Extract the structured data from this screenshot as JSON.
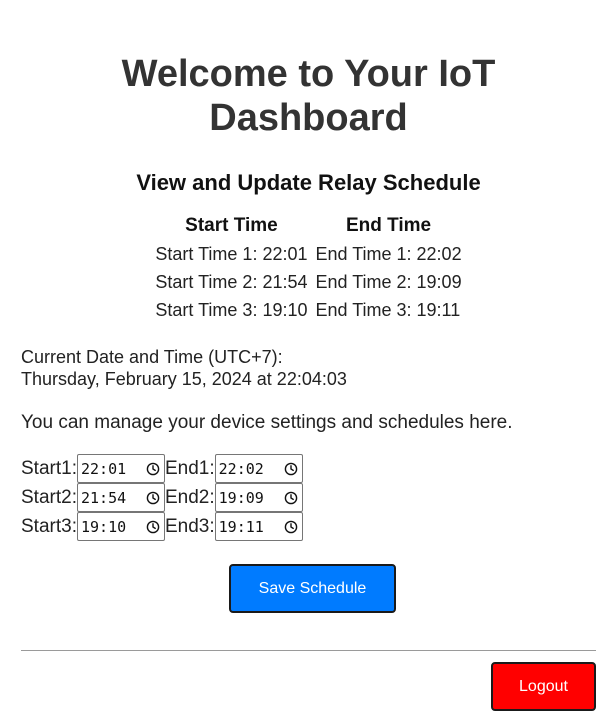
{
  "header": {
    "title": "Welcome to Your IoT Dashboard",
    "subtitle": "View and Update Relay Schedule"
  },
  "schedule_table": {
    "headers": [
      "Start Time",
      "End Time"
    ],
    "rows": [
      [
        "Start Time 1: 22:01",
        "End Time 1: 22:02"
      ],
      [
        "Start Time 2: 21:54",
        "End Time 2: 19:09"
      ],
      [
        "Start Time 3: 19:10",
        "End Time 3: 19:11"
      ]
    ]
  },
  "datetime": {
    "label": "Current Date and Time (UTC+7):",
    "value": "Thursday, February 15, 2024 at 22:04:03"
  },
  "info_text": "You can manage your device settings and schedules here.",
  "form": {
    "rows": [
      {
        "start_label": "Start1:",
        "start_value": "22:01",
        "end_label": "End1:",
        "end_value": "22:02"
      },
      {
        "start_label": "Start2:",
        "start_value": "21:54",
        "end_label": "End2:",
        "end_value": "19:09"
      },
      {
        "start_label": "Start3:",
        "start_value": "19:10",
        "end_label": "End3:",
        "end_value": "19:11"
      }
    ],
    "input_icon": "clock-icon",
    "save_label": "Save Schedule"
  },
  "logout_label": "Logout",
  "colors": {
    "save_button": "#007bff",
    "logout_button": "#ff0000",
    "title_text": "#333333"
  }
}
